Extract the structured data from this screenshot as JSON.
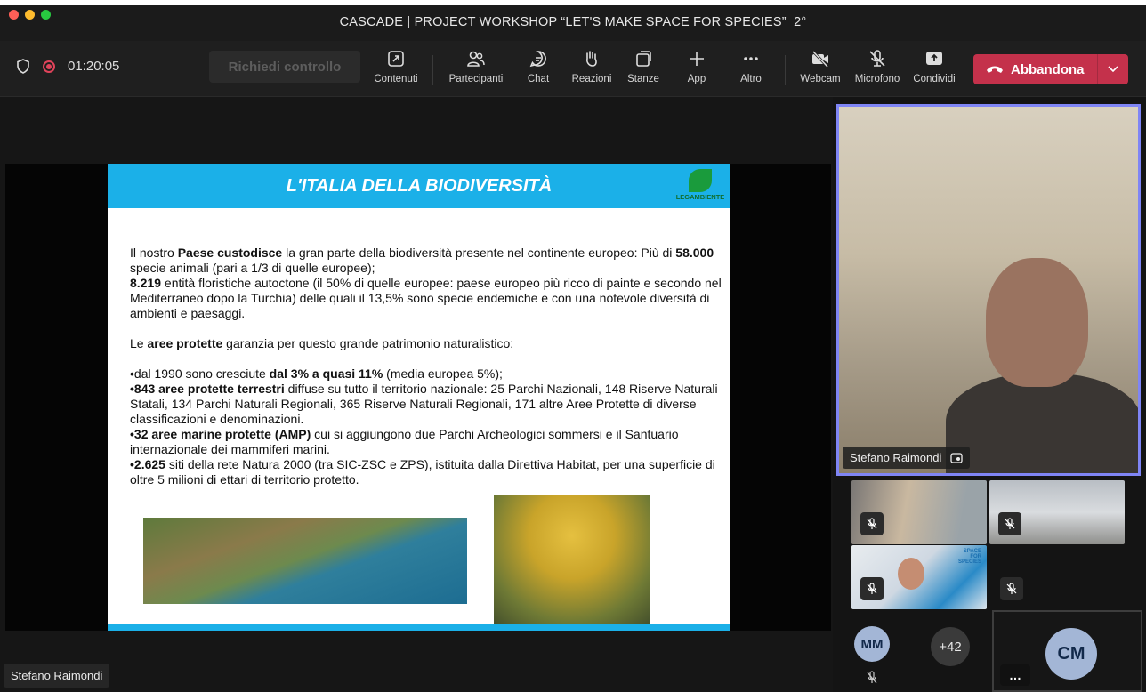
{
  "window": {
    "title": "CASCADE | PROJECT WORKSHOP “LET'S MAKE SPACE FOR SPECIES”_2°"
  },
  "toolbar": {
    "timer": "01:20:05",
    "request_control": "Richiedi controllo",
    "items": [
      {
        "label": "Contenuti",
        "icon": "share-screen-icon"
      },
      {
        "label": "Partecipanti",
        "icon": "people-icon"
      },
      {
        "label": "Chat",
        "icon": "chat-icon"
      },
      {
        "label": "Reazioni",
        "icon": "raised-hand-icon"
      },
      {
        "label": "Stanze",
        "icon": "rooms-icon"
      },
      {
        "label": "App",
        "icon": "plus-icon"
      },
      {
        "label": "Altro",
        "icon": "ellipsis-icon"
      },
      {
        "label": "Webcam",
        "icon": "camera-off-icon"
      },
      {
        "label": "Microfono",
        "icon": "mic-off-icon"
      },
      {
        "label": "Condividi",
        "icon": "share-up-icon"
      }
    ],
    "leave_label": "Abbandona"
  },
  "slide": {
    "title": "L'ITALIA DELLA BIODIVERSITÀ",
    "logo_text": "LEGAMBIENTE",
    "p1_a": "Il nostro ",
    "p1_b": "Paese custodisce",
    "p1_c": " la gran parte della biodiversità presente nel continente europeo: Più di ",
    "p1_d": "58.000",
    "p1_e": " specie animali (pari a 1/3 di quelle europee);",
    "p1_f": "8.219",
    "p1_g": " entità floristiche autoctone (il 50% di quelle europee: paese europeo più ricco di painte e secondo nel Mediterraneo dopo la Turchia) delle quali il 13,5% sono specie endemiche e con una notevole diversità di ambienti e paesaggi.",
    "p2_a": "Le ",
    "p2_b": "aree protette",
    "p2_c": " garanzia per questo grande patrimonio naturalistico:",
    "b1_a": "•dal 1990 sono cresciute ",
    "b1_b": "dal 3% a quasi 11%",
    "b1_c": " (media europea 5%);",
    "b2_a": "•843 aree protette terrestri",
    "b2_b": " diffuse su tutto il territorio nazionale: 25 Parchi Nazionali, 148 Riserve Naturali Statali, 134 Parchi Naturali Regionali, 365 Riserve Naturali Regionali, 171 altre Aree Protette di diverse classificazioni e denominazioni.",
    "b3_a": "•32 aree marine protette (AMP)",
    "b3_b": " cui si aggiungono due Parchi Archeologici sommersi e il Santuario internazionale dei mammiferi marini.",
    "b4_a": "•2.625",
    "b4_b": " siti della rete Natura 2000 (tra SIC-ZSC e ZPS), istituita dalla Direttiva Habitat, per una superficie di oltre 5 milioni di ettari di territorio protetto."
  },
  "presenter_name": "Stefano Raimondi",
  "main_video": {
    "name": "Stefano Raimondi"
  },
  "thumb_slide_text": "SPACE FOR SPECIES",
  "avatars": {
    "mm": "MM",
    "overflow": "+42",
    "cm": "CM",
    "more": "…"
  },
  "colors": {
    "leave": "#c4314b",
    "accent": "#7f85f5",
    "slide_header": "#1bb0e8"
  }
}
